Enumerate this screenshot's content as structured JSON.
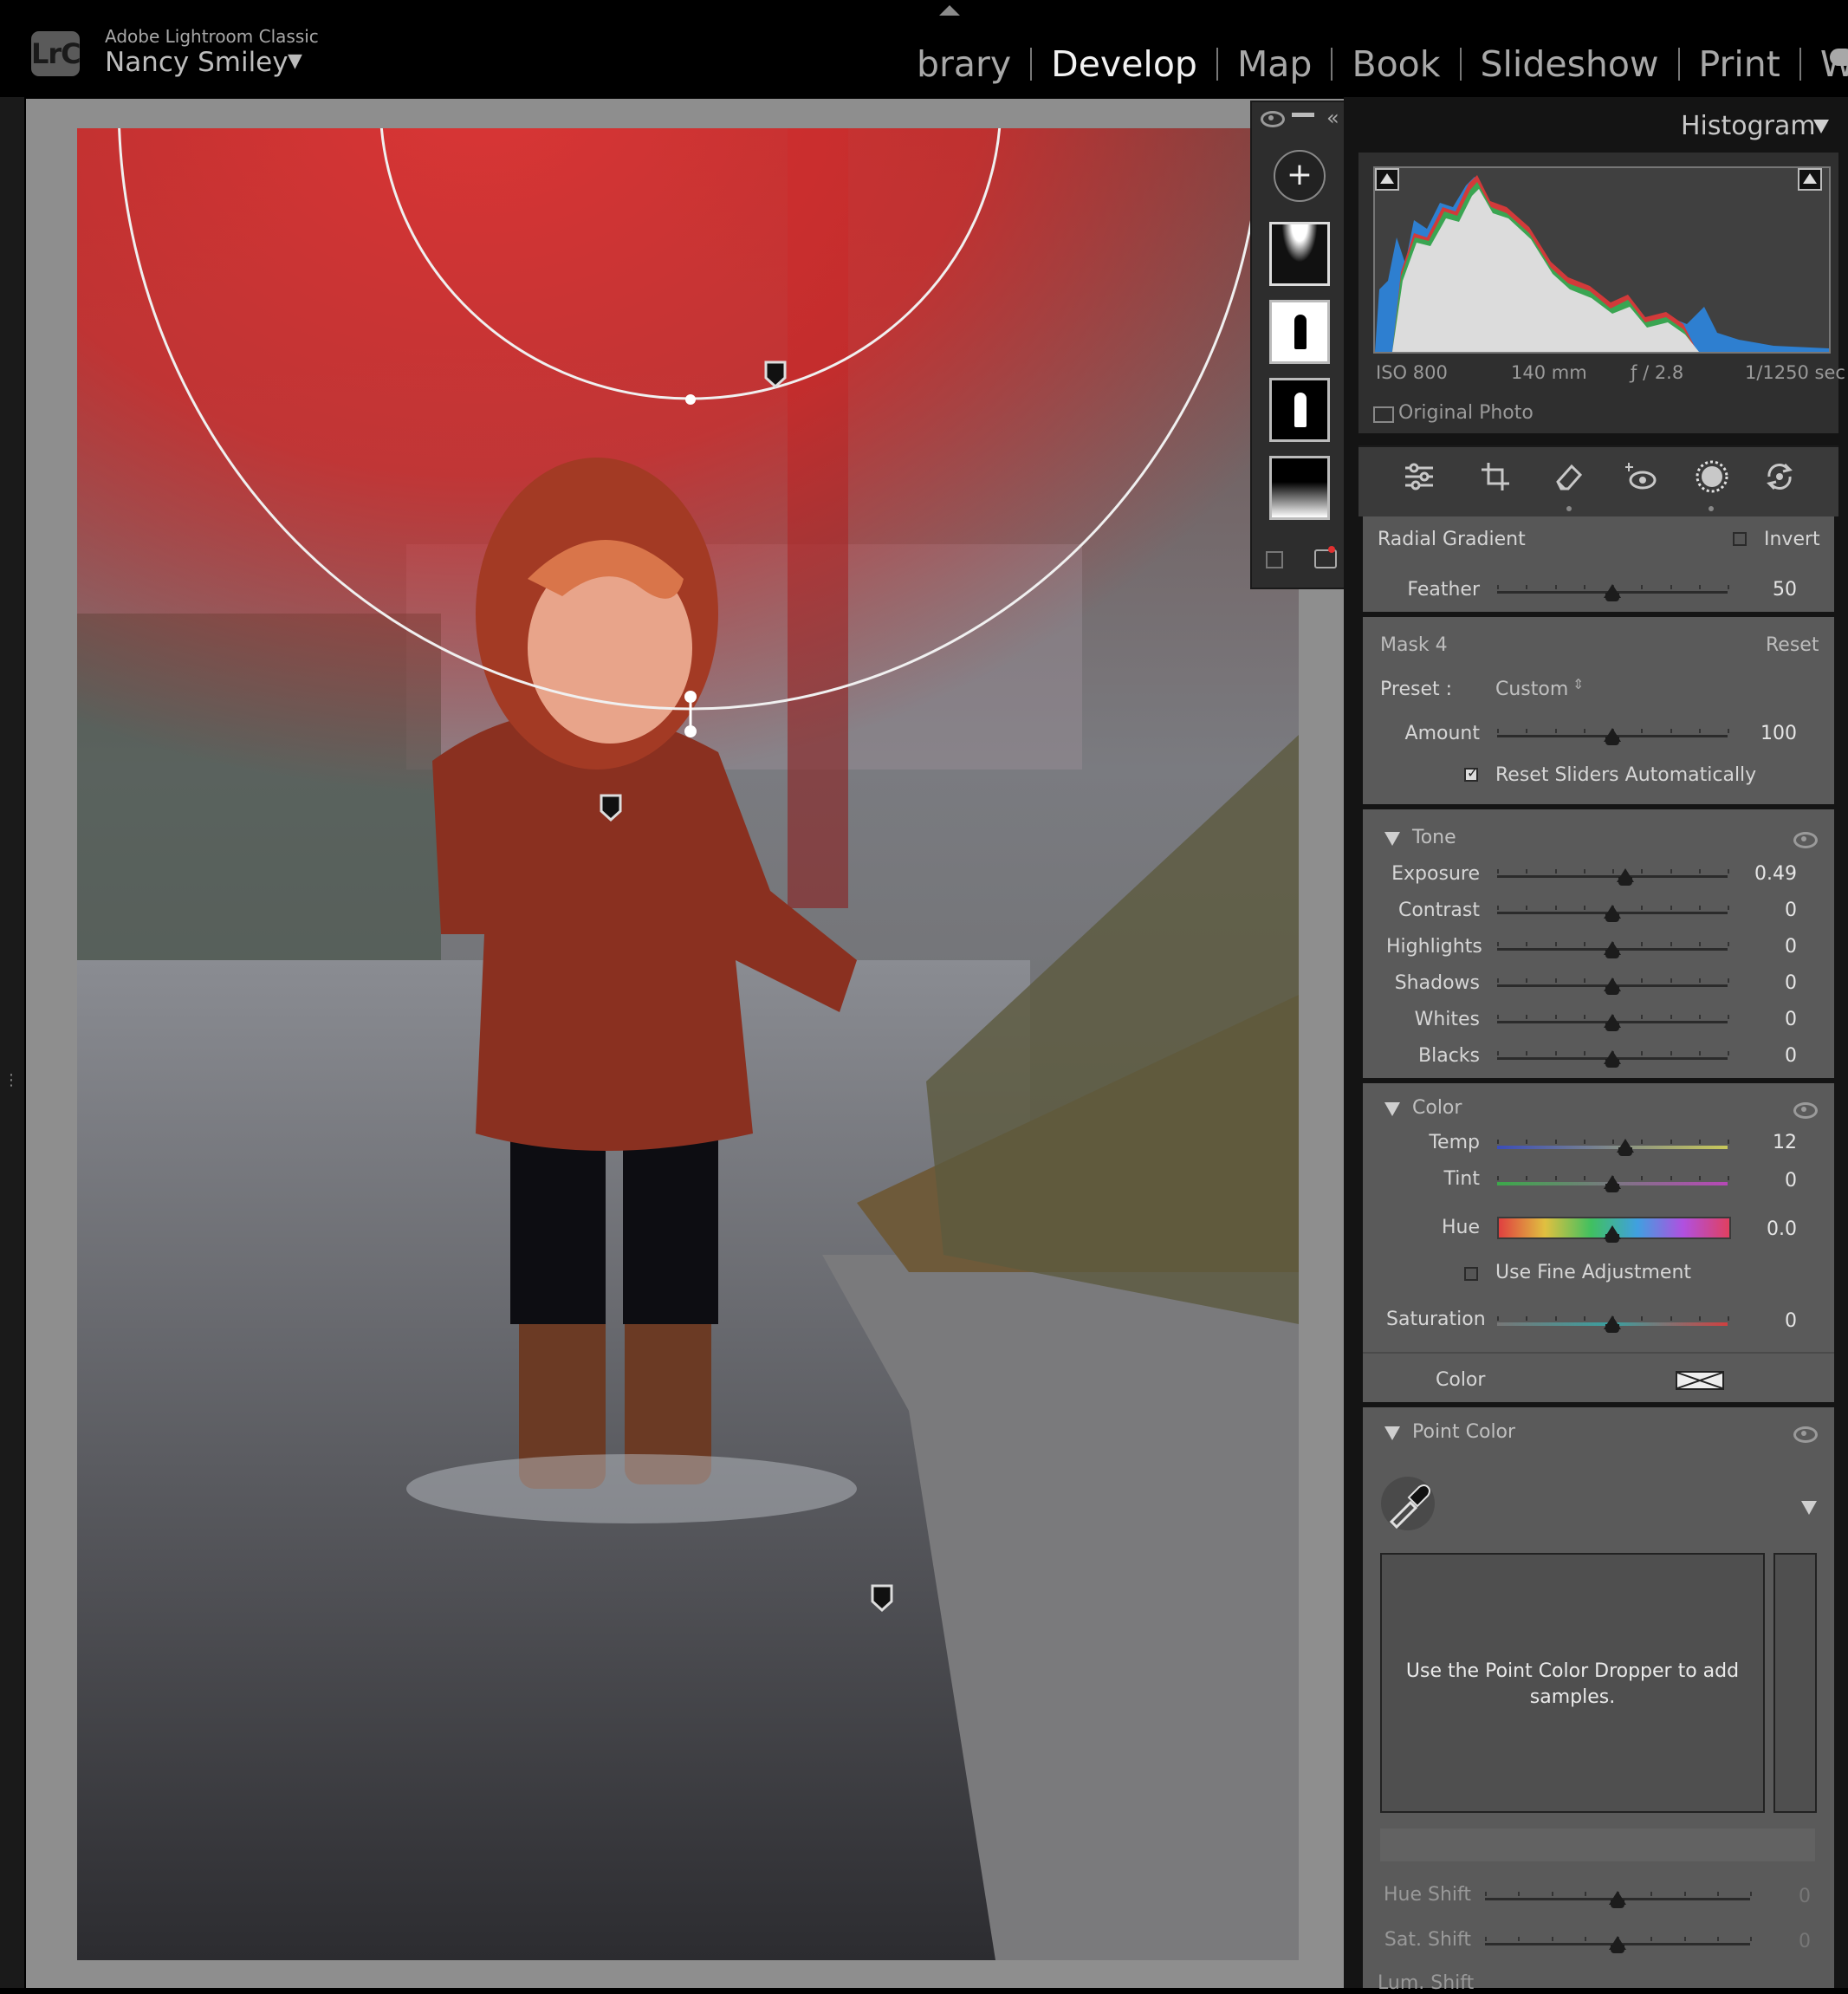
{
  "app": {
    "product": "Adobe Lightroom Classic",
    "logo": "LrC",
    "user": "Nancy Smiley"
  },
  "modules": [
    "brary",
    "Develop",
    "Map",
    "Book",
    "Slideshow",
    "Print",
    "Web"
  ],
  "active_module": "Develop",
  "histogram": {
    "title": "Histogram",
    "iso": "ISO 800",
    "focal": "140 mm",
    "aperture": "ƒ / 2.8",
    "shutter": "1/1250 sec",
    "original_photo": "Original Photo"
  },
  "tool_icons": [
    "sliders-icon",
    "crop-icon",
    "eraser-icon",
    "red-eye-icon",
    "masking-icon",
    "transform-icon"
  ],
  "radial": {
    "label": "Radial Gradient",
    "invert": "Invert",
    "feather_label": "Feather",
    "feather_value": "50",
    "feather_level": 0.5
  },
  "mask": {
    "name": "Mask 4",
    "reset": "Reset",
    "preset_label": "Preset :",
    "preset_value": "Custom",
    "amount_label": "Amount",
    "amount_value": "100",
    "amount_level": 0.5,
    "reset_sliders": "Reset Sliders Automatically"
  },
  "tone": {
    "title": "Tone",
    "sliders": [
      {
        "label": "Exposure",
        "value": "0.49",
        "level": 0.555
      },
      {
        "label": "Contrast",
        "value": "0",
        "level": 0.5
      },
      {
        "label": "Highlights",
        "value": "0",
        "level": 0.5
      },
      {
        "label": "Shadows",
        "value": "0",
        "level": 0.5
      },
      {
        "label": "Whites",
        "value": "0",
        "level": 0.5
      },
      {
        "label": "Blacks",
        "value": "0",
        "level": 0.5
      }
    ]
  },
  "color": {
    "title": "Color",
    "temp_label": "Temp",
    "temp_value": "12",
    "temp_level": 0.555,
    "tint_label": "Tint",
    "tint_value": "0",
    "tint_level": 0.5,
    "hue_label": "Hue",
    "hue_value": "0.0",
    "hue_level": 0.5,
    "fine_adjust": "Use Fine Adjustment",
    "sat_label": "Saturation",
    "sat_value": "0",
    "sat_level": 0.5,
    "color_label": "Color"
  },
  "point_color": {
    "title": "Point Color",
    "hint": "Use the Point Color Dropper to add samples.",
    "hue_shift": "Hue Shift",
    "hue_shift_value": "0",
    "sat_shift": "Sat. Shift",
    "sat_shift_value": "0",
    "lum_shift": "Lum. Shift"
  },
  "colors": {
    "mask_overlay": "#d42a2a",
    "panel": "#5a5a5a",
    "background": "#000000"
  }
}
